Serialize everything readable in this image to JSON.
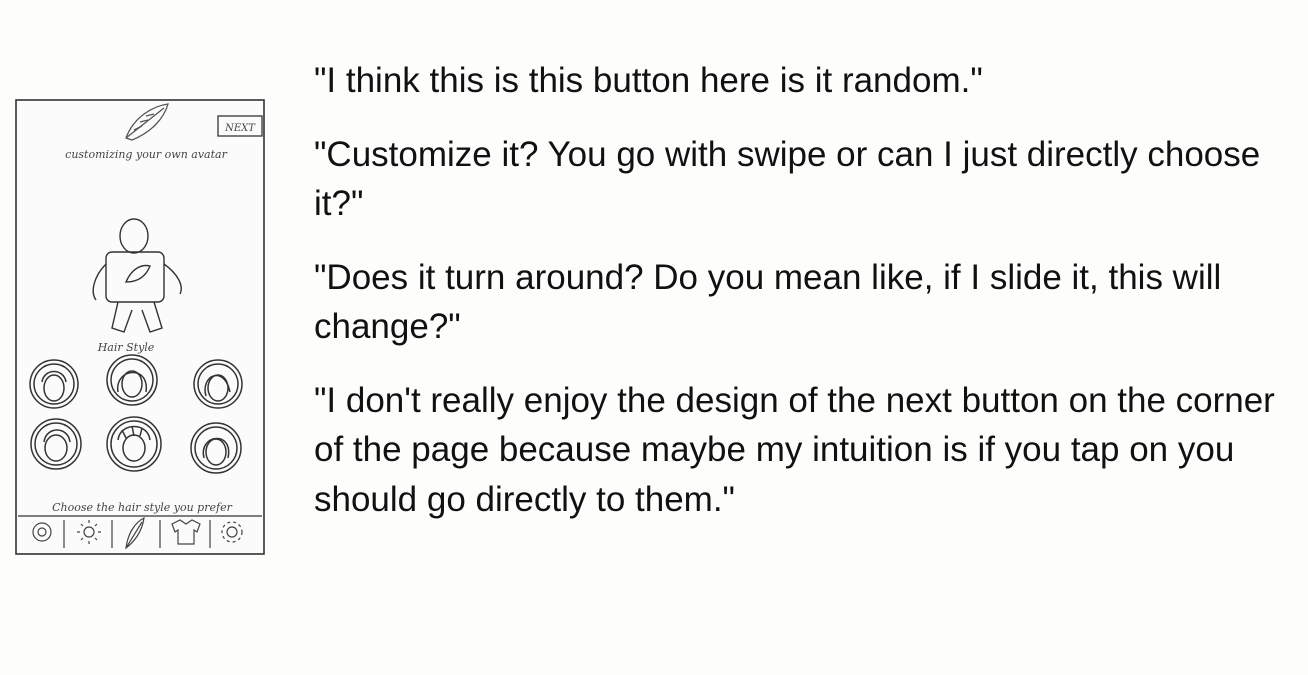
{
  "sketch": {
    "next_button": "NEXT",
    "header": "customizing your own avatar",
    "section_label": "Hair Style",
    "footer_hint": "Choose the hair style you prefer",
    "hair_options": [
      "hair-option-1",
      "hair-option-2",
      "hair-option-3",
      "hair-option-4",
      "hair-option-5",
      "hair-option-6"
    ],
    "bottom_nav_icons": [
      "face-icon",
      "sun-icon",
      "feather-icon",
      "shirt-icon",
      "gear-icon"
    ]
  },
  "quotes": [
    "\"I think this is this button here is it random.\"",
    "\"Customize it? You go with swipe or can I just directly choose it?\"",
    "\"Does it turn around? Do you mean like, if I slide it, this will change?\"",
    "\"I don't really enjoy the design of the next button on the corner of the page because maybe my intuition is if you tap on you should go directly to them.\""
  ]
}
